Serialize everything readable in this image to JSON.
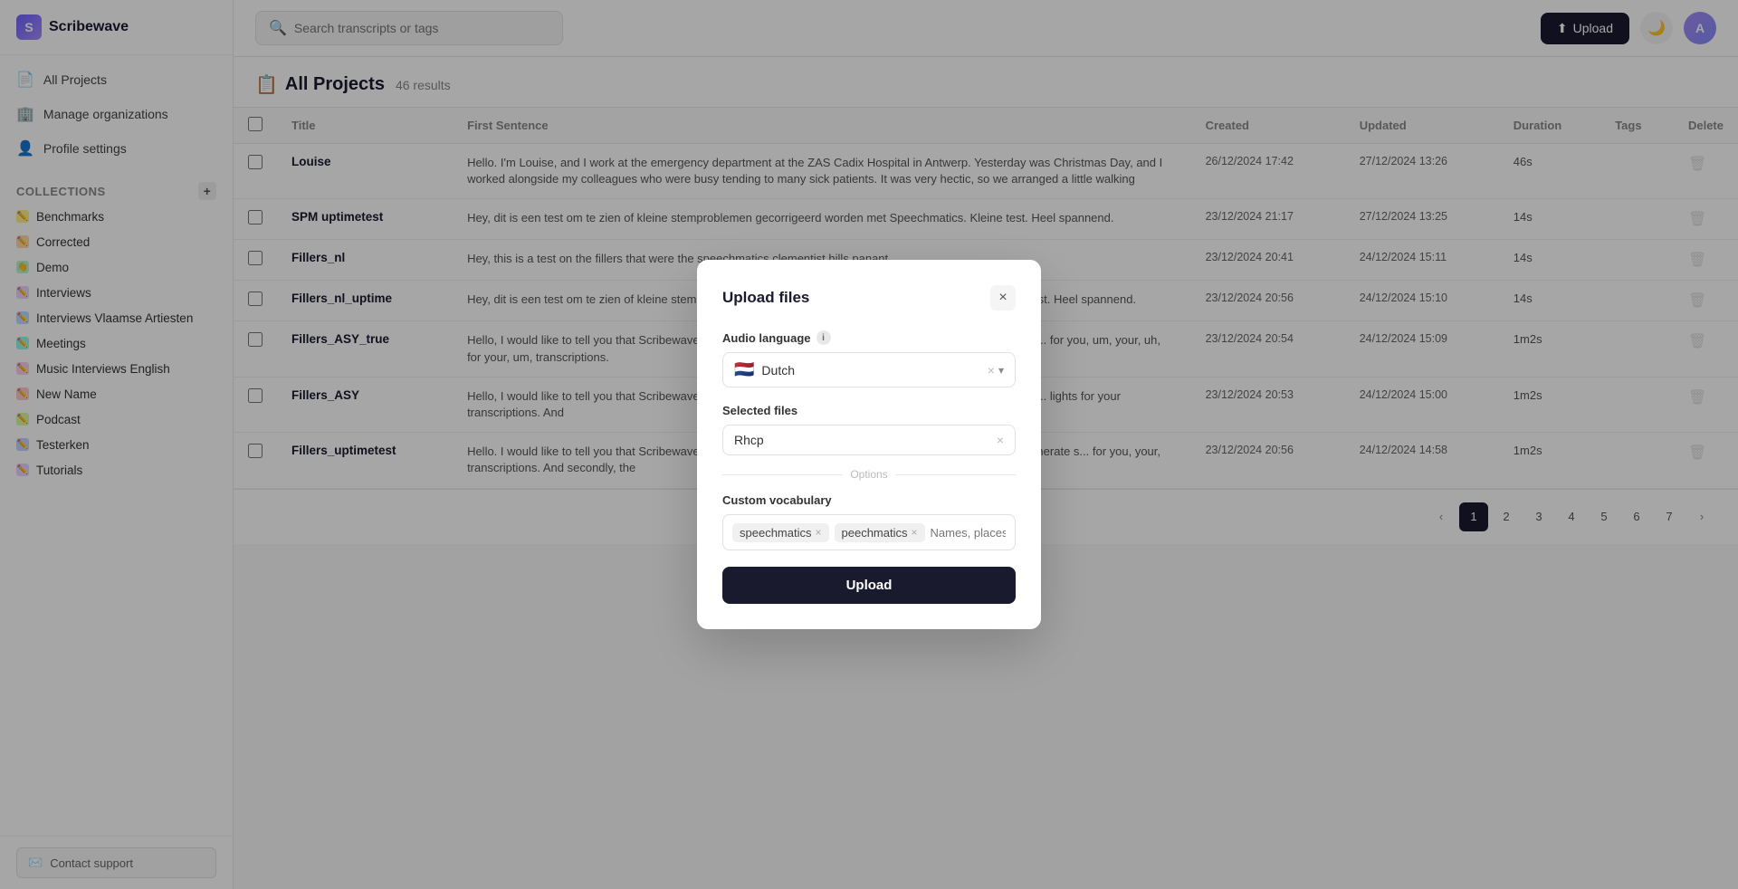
{
  "app": {
    "name": "Scribewave",
    "logo_letter": "S"
  },
  "sidebar": {
    "nav_items": [
      {
        "id": "all-projects",
        "label": "All Projects",
        "icon": "📄"
      },
      {
        "id": "manage-organizations",
        "label": "Manage organizations",
        "icon": "🏢"
      },
      {
        "id": "profile-settings",
        "label": "Profile settings",
        "icon": "👤"
      }
    ],
    "collections_title": "Collections",
    "add_icon": "+",
    "collections": [
      {
        "id": "benchmarks",
        "label": "Benchmarks",
        "color": "c-yellow"
      },
      {
        "id": "corrected",
        "label": "Corrected",
        "color": "c-orange"
      },
      {
        "id": "demo",
        "label": "Demo",
        "color": "c-green"
      },
      {
        "id": "interviews",
        "label": "Interviews",
        "color": "c-purple"
      },
      {
        "id": "interviews-vlaamse-artiesten",
        "label": "Interviews Vlaamse Artiesten",
        "color": "c-blue"
      },
      {
        "id": "meetings",
        "label": "Meetings",
        "color": "c-teal"
      },
      {
        "id": "music-interviews-english",
        "label": "Music Interviews English",
        "color": "c-pink"
      },
      {
        "id": "new-name",
        "label": "New Name",
        "color": "c-red"
      },
      {
        "id": "podcast",
        "label": "Podcast",
        "color": "c-lime"
      },
      {
        "id": "testerken",
        "label": "Testerken",
        "color": "c-indigo"
      },
      {
        "id": "tutorials",
        "label": "Tutorials",
        "color": "c-purple"
      }
    ],
    "contact_support": "Contact support"
  },
  "header": {
    "search_placeholder": "Search transcripts or tags",
    "upload_button": "Upload",
    "avatar_initials": "A"
  },
  "projects": {
    "title": "All Projects",
    "icon": "📋",
    "count": "46 results",
    "columns": [
      "",
      "Title",
      "First Sentence",
      "Created",
      "Updated",
      "Duration",
      "Tags",
      "Delete"
    ],
    "rows": [
      {
        "title": "Louise",
        "first_sentence": "Hello. I'm Louise, and I work at the emergency department at the ZAS Cadix Hospital in Antwerp. Yesterday was Christmas Day, and I worked alongside my colleagues who were busy tending to many sick patients. It was very hectic, so we arranged a little walking",
        "created": "26/12/2024 17:42",
        "updated": "27/12/2024 13:26",
        "duration": "46s",
        "tags": ""
      },
      {
        "title": "SPM uptimetest",
        "first_sentence": "Hey, dit is een test om te zien of kleine stemproblemen gecorrigeerd worden met Speechmatics. Kleine test. Heel spannend.",
        "created": "23/12/2024 21:17",
        "updated": "27/12/2024 13:25",
        "duration": "14s",
        "tags": ""
      },
      {
        "title": "Fillers_nl",
        "first_sentence": "Hey, this is a test on the fillers that were the speechmatics clementist hills panant.",
        "created": "23/12/2024 20:41",
        "updated": "24/12/2024 15:11",
        "duration": "14s",
        "tags": ""
      },
      {
        "title": "Fillers_nl_uptime",
        "first_sentence": "Hey, dit is een test om te zien of kleine stemproblemen gecorrigeerd worden met Speechmatics! Een kleine test. Heel spannend.",
        "created": "23/12/2024 20:56",
        "updated": "24/12/2024 15:10",
        "duration": "14s",
        "tags": ""
      },
      {
        "title": "Fillers_ASY_true",
        "first_sentence": "Hello, I would like to tell you that Scribewave is a very nice, tool which allows you to highlight automatically ge... for you, um, your, uh, for your, um, transcriptions.",
        "created": "23/12/2024 20:54",
        "updated": "24/12/2024 15:09",
        "duration": "1m2s",
        "tags": ""
      },
      {
        "title": "Fillers_ASY",
        "first_sentence": "Hello, I would like to tell you that Scribewave is a very nice, tool which allows you to highlight automatically ge... lights for your transcriptions. And",
        "created": "23/12/2024 20:53",
        "updated": "24/12/2024 15:00",
        "duration": "1m2s",
        "tags": ""
      },
      {
        "title": "Fillers_uptimetest",
        "first_sentence": "Hello. I would like to tell you that Scribewave is a very nice, tool which allows you to highlight automatically generate s... for you, your, transcriptions. And secondly, the",
        "created": "23/12/2024 20:56",
        "updated": "24/12/2024 14:58",
        "duration": "1m2s",
        "tags": ""
      }
    ],
    "pagination": {
      "current": 1,
      "pages": [
        "1",
        "2",
        "3",
        "4",
        "5",
        "6",
        "7"
      ]
    }
  },
  "modal": {
    "title": "Upload files",
    "close_label": "×",
    "audio_language_label": "Audio language",
    "selected_files_label": "Selected files",
    "options_divider": "Options",
    "custom_vocabulary_label": "Custom vocabulary",
    "language": {
      "flag": "🇳🇱",
      "name": "Dutch"
    },
    "selected_file": "Rhcp",
    "vocab_tags": [
      "speechmatics",
      "peechmatics"
    ],
    "vocab_placeholder": "Names, places, or othe",
    "upload_button": "Upload"
  }
}
